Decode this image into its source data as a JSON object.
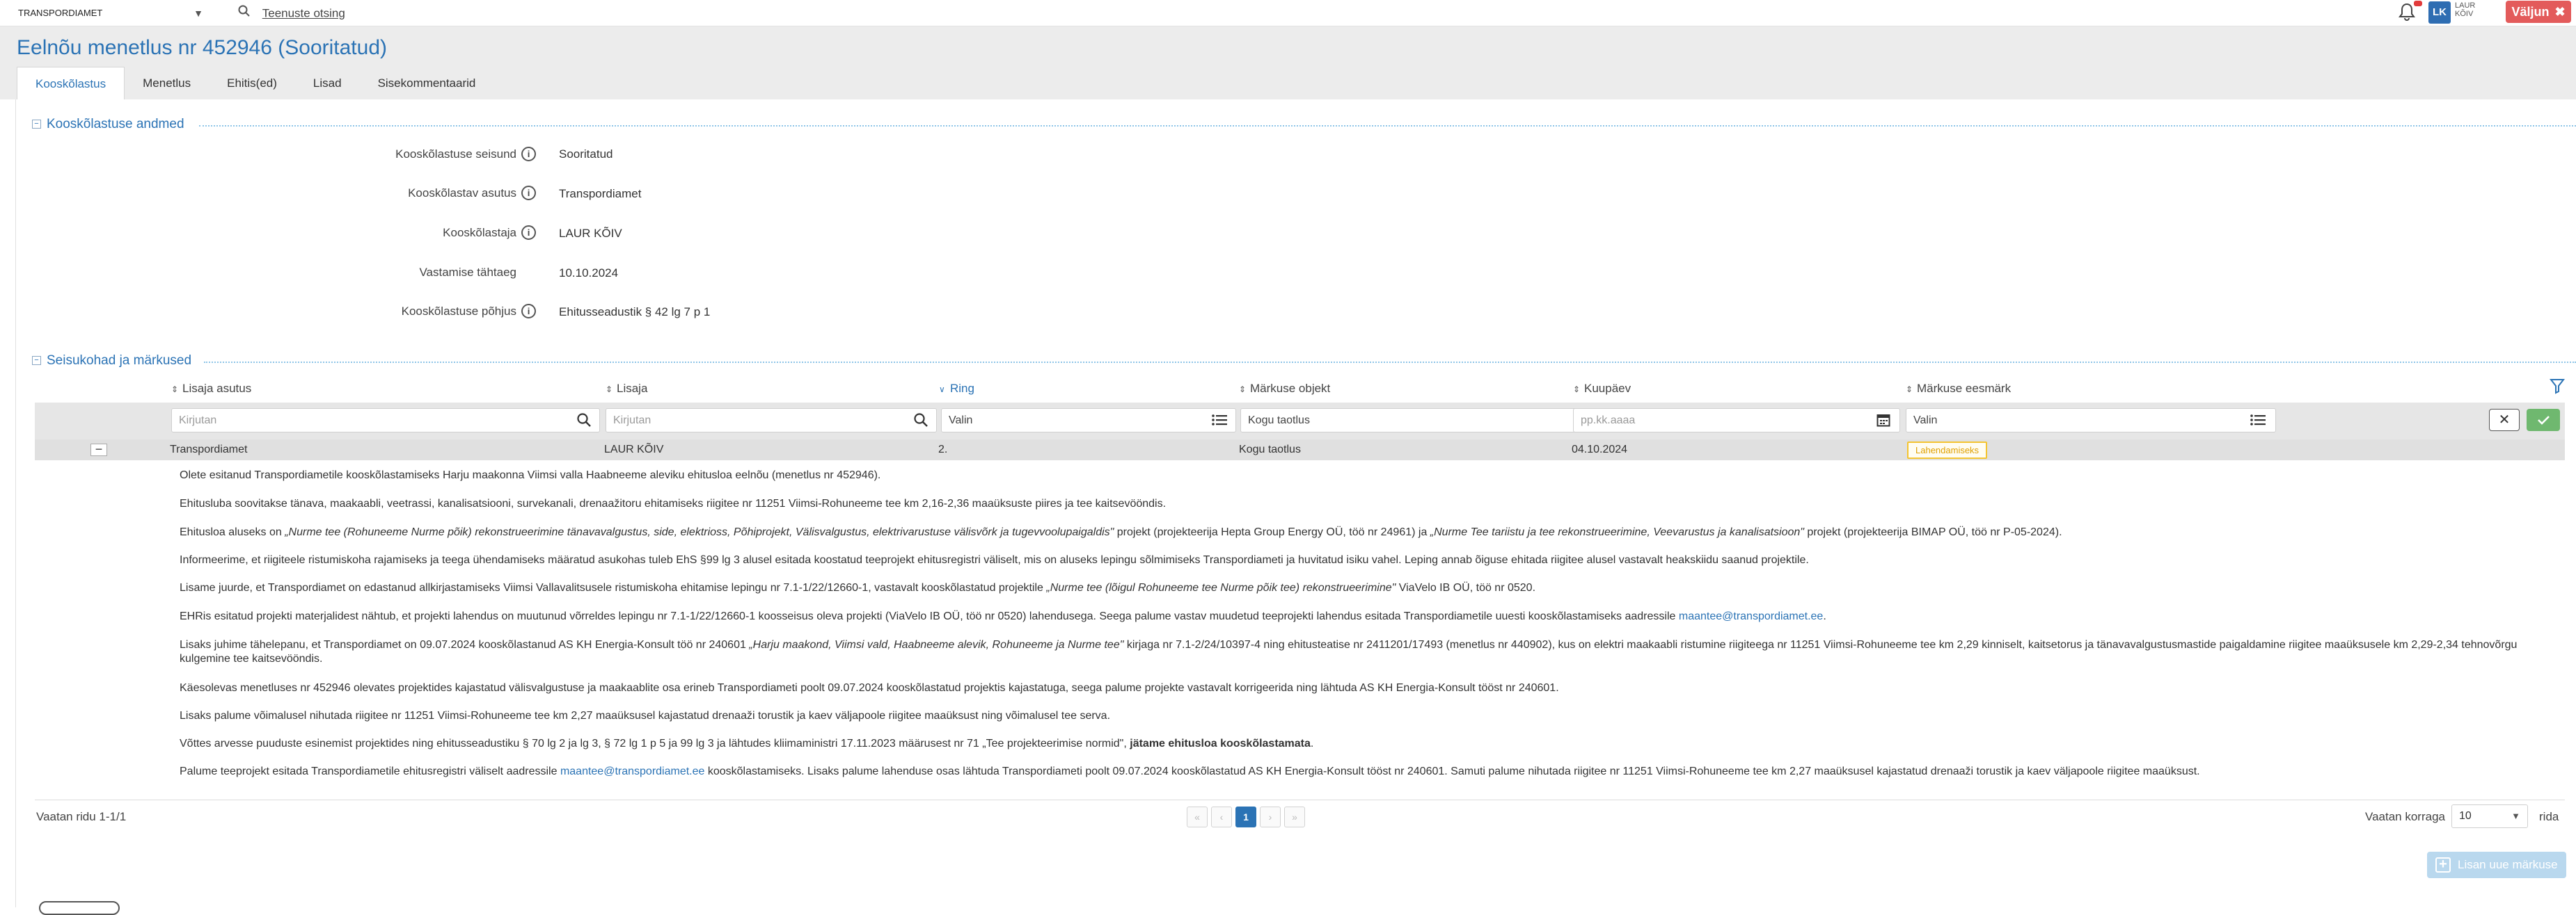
{
  "topbar": {
    "org_select": "TRANSPORDIAMET",
    "search_link": "Teenuste otsing",
    "user_initials": "LK",
    "user_name_line1": "LAUR",
    "user_name_line2": "KÕIV",
    "logout_label": "Väljun"
  },
  "page": {
    "title": "Eelnõu menetlus nr 452946 (Sooritatud)",
    "tabs": [
      "Kooskõlastus",
      "Menetlus",
      "Ehitis(ed)",
      "Lisad",
      "Sisekommentaarid"
    ],
    "active_tab": "Kooskõlastus"
  },
  "details": {
    "section_title": "Kooskõlastuse andmed",
    "rows": [
      {
        "label": "Kooskõlastuse seisund",
        "value": "Sooritatud",
        "info": true
      },
      {
        "label": "Kooskõlastav asutus",
        "value": "Transpordiamet",
        "info": true
      },
      {
        "label": "Kooskõlastaja",
        "value": "LAUR KÕIV",
        "info": true
      },
      {
        "label": "Vastamise tähtaeg",
        "value": "10.10.2024",
        "info": false
      },
      {
        "label": "Kooskõlastuse põhjus",
        "value": "Ehitusseadustik § 42 lg 7 p 1",
        "info": true
      }
    ]
  },
  "remarks": {
    "section_title": "Seisukohad ja märkused",
    "columns": [
      "Lisaja asutus",
      "Lisaja",
      "Ring",
      "Märkuse objekt",
      "Kuupäev",
      "Märkuse eesmärk"
    ],
    "filters": {
      "asutus_placeholder": "Kirjutan",
      "lisaja_placeholder": "Kirjutan",
      "ring_value": "Valin",
      "objekt_value": "Kogu taotlus",
      "kuupaev_placeholder": "pp.kk.aaaa",
      "eesmark_value": "Valin"
    },
    "row": {
      "asutus": "Transpordiamet",
      "lisaja": "LAUR KÕIV",
      "ring": "2.",
      "objekt": "Kogu taotlus",
      "kuupaev": "04.10.2024",
      "eesmark": "Lahendamiseks"
    },
    "comment": {
      "p1": "Olete esitanud Transpordiametile kooskõlastamiseks Harju maakonna Viimsi valla Haabneeme aleviku ehitusloa eelnõu (menetlus nr 452946).",
      "p2": "Ehitusluba soovitakse tänava, maakaabli, veetrassi, kanalisatsiooni, survekanali, drenaažitoru ehitamiseks riigitee nr 11251 Viimsi-Rohuneeme tee km 2,16-2,36 maaüksuste piires ja tee kaitsevööndis.",
      "p3_a": "Ehitusloa aluseks on ",
      "p3_i1": "„Nurme tee (Rohuneeme Nurme põik) rekonstrueerimine tänavavalgustus, side, elektrioss, Põhiprojekt, Välisvalgustus, elektrivarustuse välisvõrk ja tugevvoolupaigaldis\"",
      "p3_b": " projekt (projekteerija Hepta Group Energy OÜ, töö nr 24961) ja ",
      "p3_i2": "„Nurme Tee tariistu ja tee rekonstrueerimine, Veevarustus ja kanalisatsioon\"",
      "p3_c": " projekt (projekteerija BIMAP OÜ, töö nr P-05-2024).",
      "p4": "Informeerime, et riigiteele ristumiskoha rajamiseks ja teega ühendamiseks määratud asukohas tuleb EhS §99 lg 3 alusel esitada koostatud teeprojekt ehitusregistri väliselt, mis on aluseks lepingu sõlmimiseks Transpordiameti ja huvitatud isiku vahel. Leping annab õiguse ehitada riigitee alusel vastavalt heakskiidu saanud projektile.",
      "p5_a": "Lisame juurde, et Transpordiamet on edastanud allkirjastamiseks Viimsi Vallavalitsusele ristumiskoha ehitamise lepingu nr 7.1-1/22/12660-1, vastavalt kooskõlastatud projektile ",
      "p5_i": "„Nurme tee (lõigul Rohuneeme tee Nurme põik tee) rekonstrueerimine\"",
      "p5_b": " ViaVelo IB OÜ, töö nr 0520.",
      "p6_a": "EHRis esitatud projekti materjalidest nähtub, et projekti lahendus on muutunud võrreldes lepingu nr 7.1-1/22/12660-1 koosseisus oleva projekti (ViaVelo IB OÜ, töö nr 0520) lahendusega. Seega palume vastav muudetud teeprojekti lahendus esitada Transpordiametile uuesti kooskõlastamiseks aadressile ",
      "p6_link": "maantee@transpordiamet.ee",
      "p6_b": ".",
      "p7_a": "Lisaks juhime tähelepanu, et Transpordiamet on 09.07.2024 kooskõlastanud AS KH Energia-Konsult töö nr 240601 ",
      "p7_i": "„Harju maakond, Viimsi vald, Haabneeme alevik, Rohuneeme ja Nurme tee\"",
      "p7_b": " kirjaga nr 7.1-2/24/10397-4 ning ehitusteatise nr 2411201/17493 (menetlus nr 440902), kus on elektri maakaabli ristumine riigiteega nr 11251 Viimsi-Rohuneeme tee km 2,29 kinniselt, kaitsetorus ja tänavavalgustusmastide paigaldamine riigitee maaüksusele km 2,29-2,34 tehnovõrgu kulgemine tee kaitsevööndis.",
      "p8": "Käesolevas menetluses nr 452946 olevates projektides kajastatud välisvalgustuse ja maakaablite osa erineb Transpordiameti poolt 09.07.2024 kooskõlastatud projektis kajastatuga, seega palume projekte vastavalt korrigeerida ning lähtuda AS KH Energia-Konsult tööst nr 240601.",
      "p9": "Lisaks palume võimalusel nihutada riigitee nr 11251 Viimsi-Rohuneeme tee km 2,27 maaüksusel kajastatud drenaaži torustik ja kaev väljapoole riigitee maaüksust ning võimalusel tee serva.",
      "p10_a": "Võttes arvesse puuduste esinemist projektides ning ehitusseadustiku § 70 lg 2 ja lg 3, § 72 lg 1 p 5 ja 99 lg 3 ja lähtudes kliimaministri 17.11.2023 määrusest nr 71 „Tee projekteerimise normid\", ",
      "p10_bold": "jätame ehitusloa kooskõlastamata",
      "p10_b": ".",
      "p11_a": "Palume teeprojekt esitada Transpordiametile ehitusregistri väliselt aadressile ",
      "p11_link": "maantee@transpordiamet.ee",
      "p11_b": " kooskõlastamiseks. Lisaks palume lahenduse osas lähtuda Transpordiameti poolt 09.07.2024 kooskõlastatud AS KH Energia-Konsult tööst nr 240601. Samuti palume nihutada riigitee nr 11251 Viimsi-Rohuneeme tee km 2,27 maaüksusel kajastatud drenaaži torustik ja kaev väljapoole riigitee maaüksust."
    },
    "footer": {
      "rows_info": "Vaatan ridu 1-1/1",
      "pager": [
        "«",
        "‹",
        "1",
        "›",
        "»"
      ],
      "current_page": "1",
      "per_page_label": "Vaatan korraga",
      "per_page_value": "10",
      "per_page_suffix": "rida"
    },
    "add_button": "Lisan uue märkuse"
  },
  "colors": {
    "accent": "#2b73b5",
    "logout": "#e35b5b",
    "badge_border": "#f4c430",
    "apply": "#6fb86f"
  }
}
